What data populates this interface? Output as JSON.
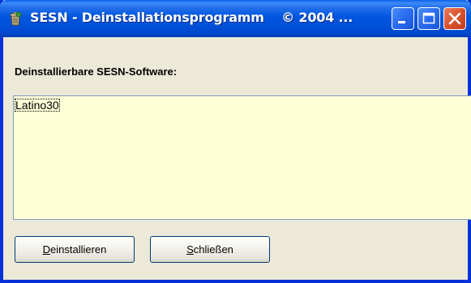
{
  "window": {
    "title": "SESN - Deinstallationsprogramm",
    "title_suffix": "© 2004 ...",
    "icon": "sesn-app-icon",
    "controls": {
      "minimize_icon": "minimize-icon",
      "maximize_icon": "maximize-icon",
      "close_icon": "close-icon"
    }
  },
  "main": {
    "list_label": "Deinstallierbare SESN-Software:",
    "list_items": [
      "Latino30"
    ],
    "selected_index": 0
  },
  "buttons": {
    "uninstall": {
      "mnemonic": "D",
      "rest": "einstallieren"
    },
    "close": {
      "mnemonic": "S",
      "rest": "chließen"
    }
  },
  "colors": {
    "titlebar": "#0054e3",
    "dialog_bg": "#ece9d8",
    "listbox_bg": "#ffffd8",
    "close_button": "#d9532f"
  }
}
